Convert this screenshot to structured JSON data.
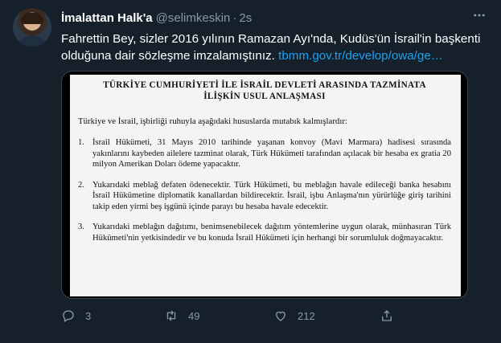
{
  "tweet": {
    "author_name": "İmalattan Halk'a",
    "handle": "@selimkeskin",
    "separator": "·",
    "time": "2s",
    "text": "Fahrettin Bey, sizler 2016 yılının Ramazan Ayı'nda, Kudüs'ün İsrail'in başkenti olduğuna dair sözleşme imzalamıştınız.",
    "link_text": "tbmm.gov.tr/develop/owa/ge…",
    "more_icon": "more-icon"
  },
  "document": {
    "title_line1": "TÜRKİYE CUMHURİYETİ İLE İSRAİL DEVLETİ ARASINDA TAZMİNATA",
    "title_line2": "İLİŞKİN USUL ANLAŞMASI",
    "intro": "Türkiye ve İsrail, işbirliği ruhuyla aşağıdaki hususlarda mutabık kalmışlardır:",
    "items": [
      {
        "num": "1.",
        "text": "İsrail Hükümeti, 31 Mayıs 2010 tarihinde yaşanan konvoy (Mavi Marmara) hadisesi sırasında yakınlarını kaybeden ailelere tazminat olarak, Türk Hükümeti tarafından açılacak bir hesaba ex gratia 20 milyon Amerikan Doları ödeme yapacaktır."
      },
      {
        "num": "2.",
        "text": "Yukarıdaki meblağ defaten ödenecektir. Türk Hükümeti, bu meblağın havale edileceği banka hesabını İsrail Hükümetine diplomatik kanallardan bildirecektir. İsrail, işbu Anlaşma'nın yürürlüğe giriş tarihini takip eden yirmi beş işgünü içinde parayı bu hesaba havale edecektir."
      },
      {
        "num": "3.",
        "text": "Yukarıdaki meblağın dağıtımı, benimsenebilecek dağıtım yöntemlerine uygun olarak, münhasıran Türk Hükümeti'nin yetkisindedir ve bu konuda İsrail Hükümeti için herhangi bir sorumluluk doğmayacaktır."
      }
    ]
  },
  "actions": {
    "reply_count": "3",
    "retweet_count": "49",
    "like_count": "212"
  },
  "colors": {
    "background": "#15202b",
    "secondary_text": "#8899a6",
    "link": "#1da1f2"
  }
}
